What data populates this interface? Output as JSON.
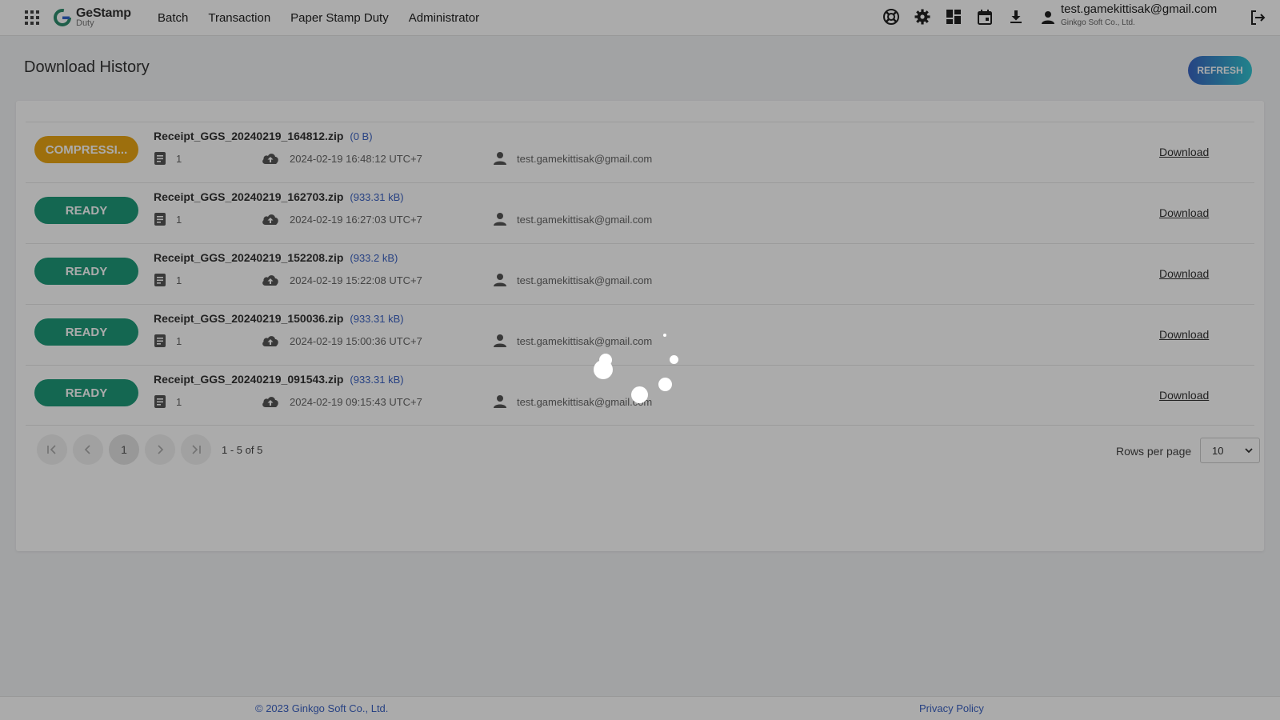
{
  "header": {
    "brand_main": "GeStamp",
    "brand_sub": "Duty",
    "nav": [
      "Batch",
      "Transaction",
      "Paper Stamp Duty",
      "Administrator"
    ],
    "icons": [
      "support-icon",
      "settings-icon",
      "dashboard-icon",
      "calendar-icon",
      "download-icon"
    ],
    "user_email": "test.gamekittisak@gmail.com",
    "user_company": "Ginkgo Soft Co., Ltd."
  },
  "page": {
    "title": "Download History",
    "refresh_label": "REFRESH"
  },
  "downloads": [
    {
      "status": "COMPRESSI...",
      "status_type": "compressing",
      "file": "Receipt_GGS_20240219_164812.zip",
      "size": "(0 B)",
      "count": "1",
      "datetime": "2024-02-19 16:48:12 UTC+7",
      "user": "test.gamekittisak@gmail.com",
      "action": "Download"
    },
    {
      "status": "READY",
      "status_type": "ready",
      "file": "Receipt_GGS_20240219_162703.zip",
      "size": "(933.31 kB)",
      "count": "1",
      "datetime": "2024-02-19 16:27:03 UTC+7",
      "user": "test.gamekittisak@gmail.com",
      "action": "Download"
    },
    {
      "status": "READY",
      "status_type": "ready",
      "file": "Receipt_GGS_20240219_152208.zip",
      "size": "(933.2 kB)",
      "count": "1",
      "datetime": "2024-02-19 15:22:08 UTC+7",
      "user": "test.gamekittisak@gmail.com",
      "action": "Download"
    },
    {
      "status": "READY",
      "status_type": "ready",
      "file": "Receipt_GGS_20240219_150036.zip",
      "size": "(933.31 kB)",
      "count": "1",
      "datetime": "2024-02-19 15:00:36 UTC+7",
      "user": "test.gamekittisak@gmail.com",
      "action": "Download"
    },
    {
      "status": "READY",
      "status_type": "ready",
      "file": "Receipt_GGS_20240219_091543.zip",
      "size": "(933.31 kB)",
      "count": "1",
      "datetime": "2024-02-19 09:15:43 UTC+7",
      "user": "test.gamekittisak@gmail.com",
      "action": "Download"
    }
  ],
  "pagination": {
    "current_page": "1",
    "range": "1 - 5 of 5",
    "rows_label": "Rows per page",
    "rows_value": "10"
  },
  "footer": {
    "copyright": "© 2023 Ginkgo Soft Co., Ltd.",
    "privacy": "Privacy Policy"
  },
  "colors": {
    "ready": "#1f9a7a",
    "compressing": "#eaa614",
    "link": "#3c63c4",
    "overlay": "rgba(0,0,0,0.33)"
  }
}
